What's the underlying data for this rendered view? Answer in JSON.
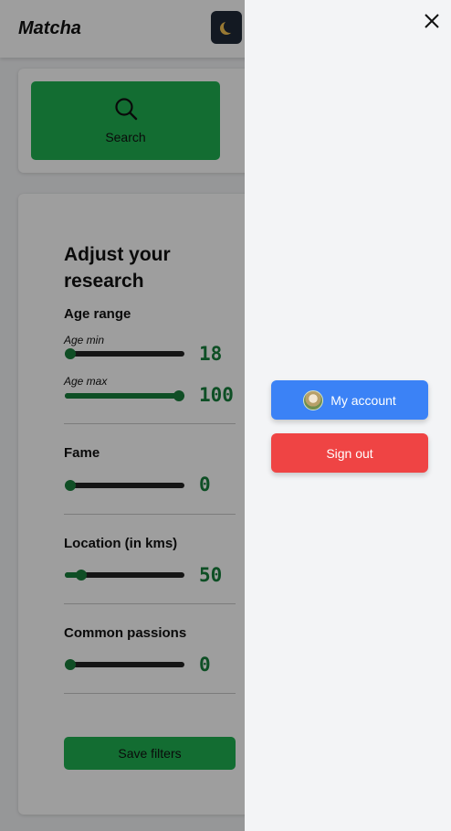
{
  "header": {
    "brand": "Matcha",
    "theme_toggle_icon": "moon-icon"
  },
  "search": {
    "label": "Search",
    "icon": "search-icon"
  },
  "filters": {
    "title": "Adjust your research",
    "age_range": {
      "label": "Age range",
      "min_label": "Age min",
      "max_label": "Age max",
      "min_value": "18",
      "max_value": "100",
      "min_fraction": 0,
      "max_fraction": 1
    },
    "fame": {
      "label": "Fame",
      "value": "0",
      "fraction": 0
    },
    "location": {
      "label": "Location (in kms)",
      "value": "50",
      "fraction": 0.1
    },
    "passions": {
      "label": "Common passions",
      "value": "0",
      "fraction": 0
    },
    "save_label": "Save filters"
  },
  "drawer": {
    "account_label": "My account",
    "signout_label": "Sign out",
    "close_icon": "close-icon"
  },
  "colors": {
    "accent_green": "#1fb052",
    "value_green": "#17803d",
    "account_blue": "#3b82f6",
    "signout_red": "#ef4444"
  }
}
